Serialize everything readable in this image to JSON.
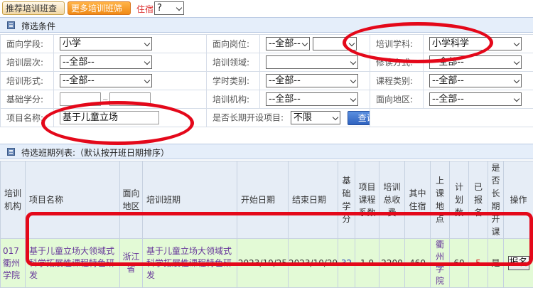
{
  "tabs": {
    "recommended": "推荐培训班查询",
    "more_filter": "更多培训班筛选",
    "dorm_label": "住宿",
    "dorm_value": "?"
  },
  "filter_section": {
    "title": "筛选条件"
  },
  "filters": {
    "stage_label": "面向学段:",
    "stage_value": "小学",
    "post_label": "面向岗位:",
    "post_value": "--全部--",
    "subject_label": "培训学科:",
    "subject_value": "小学科学",
    "level_label": "培训层次:",
    "level_value": "--全部--",
    "field_label": "培训领域:",
    "field_value": "",
    "mode_label": "修读方式:",
    "mode_value": "--全部--",
    "form_label": "培训形式:",
    "form_value": "--全部--",
    "hours_label": "学时类别:",
    "hours_value": "--全部--",
    "course_type_label": "课程类别:",
    "course_type_value": "--全部--",
    "credit_label": "基础学分:",
    "credit_sep": "~",
    "org_label": "培训机构:",
    "org_value": "--全部--",
    "region_label": "面向地区:",
    "region_value": "--全部--",
    "project_label": "项目名称:",
    "project_value": "基于儿童立场",
    "longterm_label": "是否长期开设项目:",
    "longterm_value": "不限",
    "query_button": "查询"
  },
  "results_section": {
    "title": "待选班期列表:（默认按开班日期排序）"
  },
  "results": {
    "headers": [
      "培训机构",
      "项目名称",
      "面向地区",
      "培训班期",
      "开始日期",
      "结束日期",
      "基础学分",
      "项目课程系数",
      "培训总收费",
      "其中住宿",
      "上课地点",
      "计划数",
      "已报名",
      "是否长期开课",
      "操作"
    ],
    "rows": [
      {
        "org": "017衢州学院",
        "project": "基于儿童立场大领域式科学拓展性课程特色研发",
        "region": "浙江省",
        "session": "基于儿童立场大领域式科学拓展性课程特色研发",
        "start": "2023/10/25",
        "end": "2023/10/29",
        "credit": "32",
        "coef": "1.0",
        "fee": "2200",
        "dorm": "460",
        "place": "衢州学院",
        "plan": "60",
        "enrolled": "5",
        "longterm": "是",
        "action": "报名"
      }
    ]
  },
  "colors": {
    "annotation": "#e4081a",
    "row_bg": "#e3fad6",
    "header_bg": "#e6edf6"
  }
}
